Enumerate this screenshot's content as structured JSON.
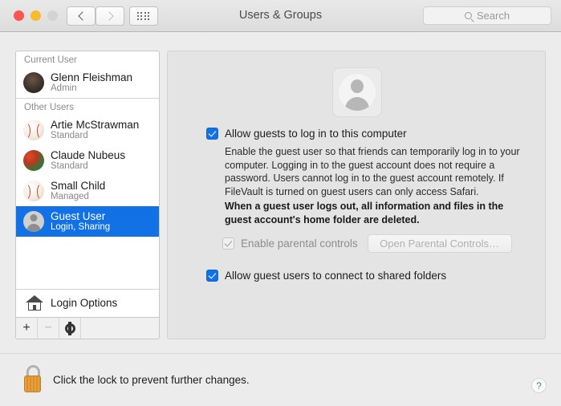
{
  "window": {
    "title": "Users & Groups",
    "traffic_lights": [
      "close",
      "minimize",
      "zoom"
    ],
    "back_label": "Back",
    "forward_label": "Forward",
    "grid_label": "Show All"
  },
  "search": {
    "placeholder": "Search",
    "value": "",
    "icon": "search-icon"
  },
  "sidebar": {
    "groups": [
      {
        "header": "Current User",
        "users": [
          {
            "name": "Glenn Fleishman",
            "role": "Admin",
            "avatar": "photo",
            "selected": false
          }
        ]
      },
      {
        "header": "Other Users",
        "users": [
          {
            "name": "Artie McStrawman",
            "role": "Standard",
            "avatar": "baseball",
            "selected": false
          },
          {
            "name": "Claude Nubeus",
            "role": "Standard",
            "avatar": "color",
            "selected": false
          },
          {
            "name": "Small Child",
            "role": "Managed",
            "avatar": "baseball",
            "selected": false
          },
          {
            "name": "Guest User",
            "role": "Login, Sharing",
            "avatar": "guest",
            "selected": true
          }
        ]
      }
    ],
    "login_options": "Login Options",
    "toolbar": {
      "add": "+",
      "remove": "−",
      "settings": "gear-icon"
    }
  },
  "main": {
    "avatar_alt": "Guest User picture",
    "allow_guests": {
      "label": "Allow guests to log in to this computer",
      "checked": true,
      "enabled": true
    },
    "description": "Enable the guest user so that friends can temporarily log in to your computer. Logging in to the guest account does not require a password. Users cannot log in to the guest account remotely. If FileVault is turned on guest users can only access Safari.",
    "warning": "When a guest user logs out, all information and files in the guest account's home folder are deleted.",
    "parental_controls": {
      "label": "Enable parental controls",
      "checked": true,
      "enabled": false
    },
    "open_parental_button": {
      "label": "Open Parental Controls…",
      "enabled": false
    },
    "shared_folders": {
      "label": "Allow guest users to connect to shared folders",
      "checked": true,
      "enabled": true
    }
  },
  "footer": {
    "lock_state": "unlocked",
    "lock_text": "Click the lock to prevent further changes.",
    "help_label": "?"
  },
  "colors": {
    "selection_blue": "#1272e5",
    "checkbox_blue": "#1272e5",
    "lock_gold": "#e8a13c",
    "help_blue": "#4a7fc1",
    "window_bg": "#ececec",
    "panel_bg": "#e4e4e4"
  }
}
